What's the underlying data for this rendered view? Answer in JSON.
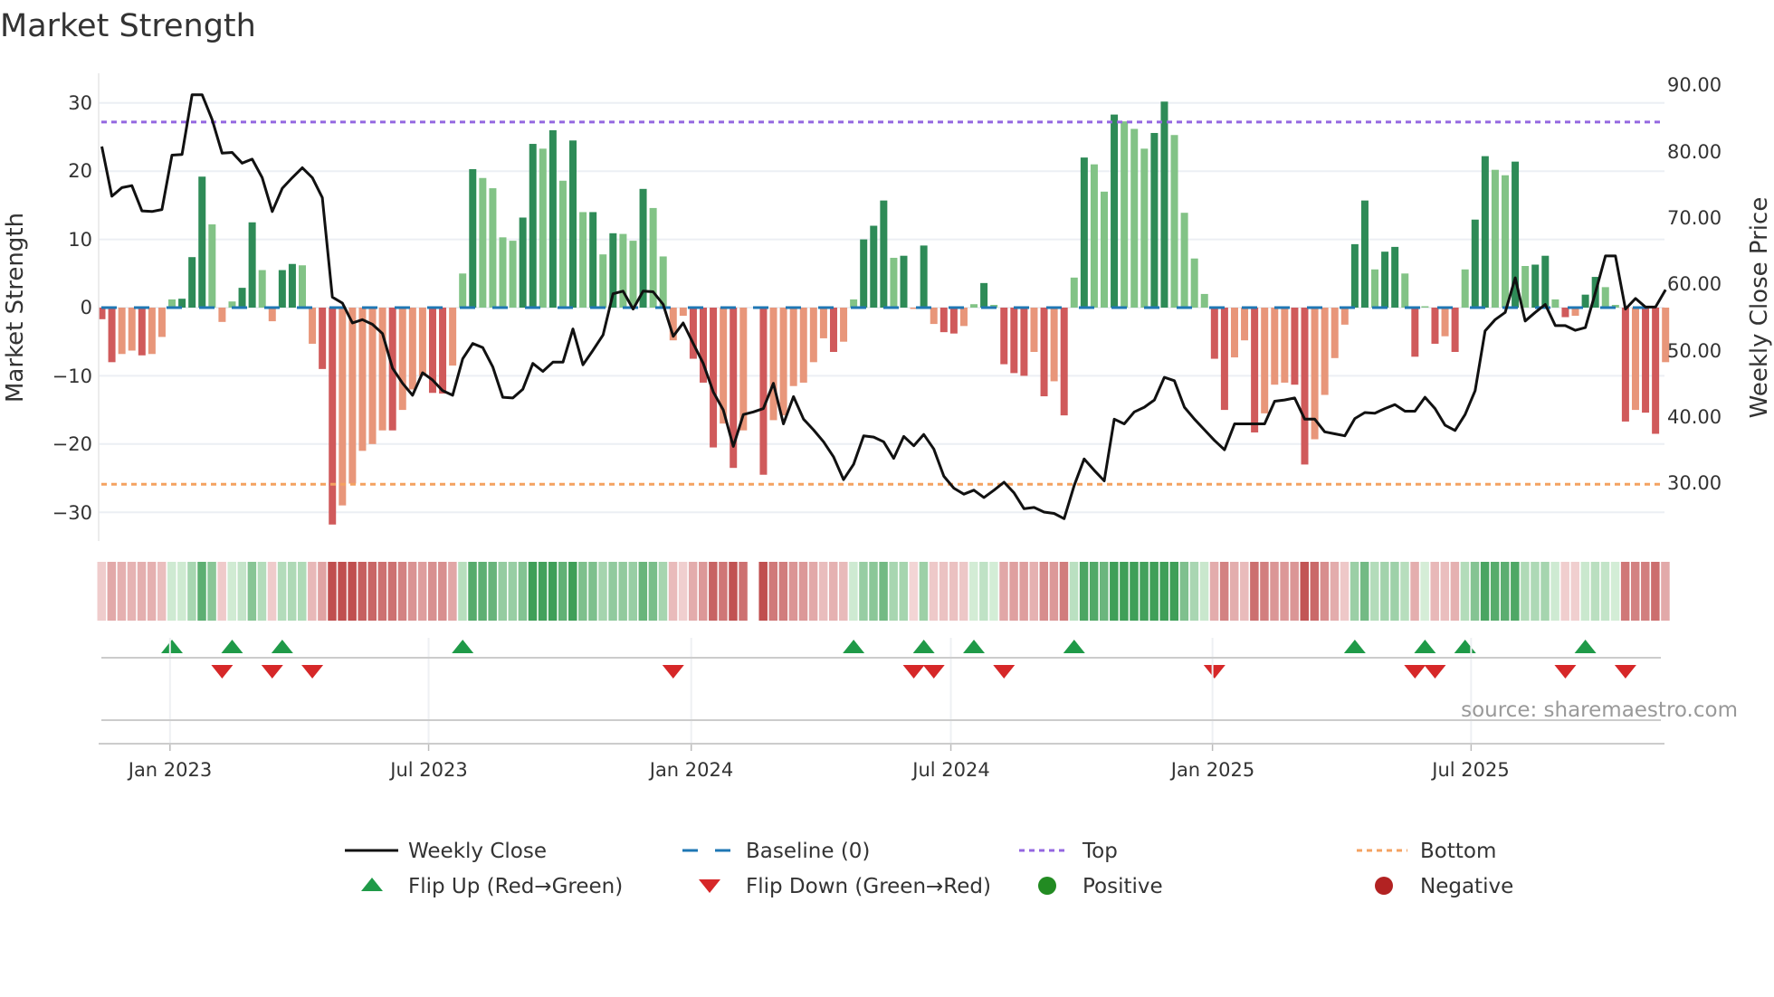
{
  "chart_data": {
    "type": "bar",
    "title": "Market Strength",
    "ylabel": "Market Strength",
    "y2label": "Weekly Close Price",
    "ylim": [
      -34.5,
      34.5
    ],
    "y2lim": [
      21.3,
      91.7
    ],
    "yticks": [
      {
        "value": 30,
        "label": "30"
      },
      {
        "value": 20,
        "label": "20"
      },
      {
        "value": 10,
        "label": "10"
      },
      {
        "value": 0,
        "label": "0"
      },
      {
        "value": -10,
        "label": "−10"
      },
      {
        "value": -20,
        "label": "−20"
      },
      {
        "value": -30,
        "label": "−30"
      }
    ],
    "y2ticks": [
      {
        "value": 90,
        "label": "90.00"
      },
      {
        "value": 80,
        "label": "80.00"
      },
      {
        "value": 70,
        "label": "70.00"
      },
      {
        "value": 60,
        "label": "60.00"
      },
      {
        "value": 50,
        "label": "50.00"
      },
      {
        "value": 40,
        "label": "40.00"
      },
      {
        "value": 30,
        "label": "30.00"
      }
    ],
    "xticks": [
      {
        "week": 6.8,
        "label": "Jan 2023"
      },
      {
        "week": 32.6,
        "label": "Jul 2023"
      },
      {
        "week": 58.8,
        "label": "Jan 2024"
      },
      {
        "week": 84.7,
        "label": "Jul 2024"
      },
      {
        "week": 110.8,
        "label": "Jan 2025"
      },
      {
        "week": 136.6,
        "label": "Jul 2025"
      }
    ],
    "grid": true,
    "top_threshold": 27.2,
    "bottom_threshold": -25.9,
    "strength": [
      -1.7,
      -8,
      -6.8,
      -6.3,
      -7,
      -6.8,
      -4.3,
      1.2,
      1.3,
      7.4,
      19.2,
      12.2,
      -2.1,
      0.9,
      2.9,
      12.5,
      5.5,
      -2,
      5.5,
      6.4,
      6.2,
      -5.3,
      -9,
      -31.8,
      -29,
      -25.8,
      -21,
      -20,
      -18,
      -18,
      -15,
      -12,
      -10,
      -12.5,
      -12.6,
      -8.5,
      5,
      20.3,
      19,
      17.5,
      10.3,
      9.8,
      13.2,
      24,
      23.3,
      26,
      18.6,
      24.5,
      14,
      14,
      7.8,
      10.9,
      10.8,
      9.8,
      17.4,
      14.6,
      7.5,
      -4.8,
      -1.2,
      -7.5,
      -11,
      -20.5,
      -17,
      -23.5,
      -18,
      null,
      -24.5,
      -16.5,
      -15.8,
      -11.5,
      -11,
      -8,
      -4.5,
      -6.5,
      -5,
      1.2,
      10,
      12,
      15.7,
      7.3,
      7.6,
      -0.2,
      9.1,
      -2.4,
      -3.6,
      -3.8,
      -2.7,
      0.5,
      3.6,
      0.4,
      -8.3,
      -9.6,
      -10,
      -6.5,
      -13,
      -10.8,
      -15.8,
      4.4,
      22,
      21,
      17,
      28.3,
      27.3,
      26.2,
      23.3,
      25.6,
      30.2,
      25.3,
      13.9,
      7.2,
      2,
      -7.5,
      -15,
      -7.3,
      -4.8,
      -18.3,
      -15.5,
      -11.3,
      -11,
      -11.3,
      -23,
      -19.3,
      -12.8,
      -7.4,
      -2.5,
      9.3,
      15.7,
      5.6,
      8.2,
      8.9,
      5,
      -7.2,
      0.2,
      -5.3,
      -4.2,
      -6.5,
      5.6,
      12.9,
      22.2,
      20.2,
      19.4,
      21.4,
      6.1,
      6.3,
      7.6,
      1.2,
      -1.4,
      -1.2,
      1.9,
      4.5,
      3,
      0.4,
      -16.7,
      -15,
      -15.4,
      -18.5,
      -8
    ],
    "weekly_close": [
      80.7,
      73.2,
      74.5,
      74.8,
      71,
      70.9,
      71.2,
      79.4,
      79.5,
      88.5,
      88.5,
      84.8,
      79.7,
      79.8,
      78.2,
      78.8,
      76,
      70.9,
      74.4,
      76,
      77.5,
      76,
      73,
      58,
      57.1,
      54.1,
      54.6,
      53.9,
      52.5,
      47.3,
      45,
      43.2,
      46.6,
      45.5,
      43.9,
      43.2,
      48.7,
      51,
      50.4,
      47.5,
      42.9,
      42.8,
      44.1,
      48,
      46.8,
      48.2,
      48.2,
      53.2,
      47.8,
      50,
      52.3,
      58.5,
      58.9,
      56.2,
      58.9,
      58.8,
      56.9,
      52.1,
      54.1,
      51,
      48,
      43.7,
      41,
      35.5,
      40.3,
      40.7,
      41.2,
      45,
      38.9,
      43,
      39.6,
      38,
      36.2,
      33.9,
      30.5,
      32.8,
      37.1,
      36.9,
      36.2,
      33.7,
      37,
      35.6,
      37.3,
      35.1,
      31,
      29.2,
      28.3,
      28.9,
      27.8,
      28.9,
      30.1,
      28.5,
      26.1,
      26.3,
      25.6,
      25.4,
      24.6,
      29.6,
      33.6,
      31.9,
      30.3,
      39.6,
      38.9,
      40.7,
      41.4,
      42.5,
      45.9,
      45.4,
      41.4,
      39.6,
      38,
      36.4,
      35,
      38.9,
      38.9,
      38.9,
      38.9,
      42.3,
      42.5,
      42.8,
      39.6,
      39.6,
      37.7,
      37.4,
      37.1,
      39.7,
      40.6,
      40.5,
      41.2,
      41.8,
      40.8,
      40.8,
      42.9,
      41.2,
      38.7,
      37.9,
      40.3,
      43.9,
      52.9,
      54.6,
      55.7,
      60.9,
      54.4,
      55.7,
      56.9,
      53.7,
      53.7,
      53,
      53.4,
      58.7,
      64.2,
      64.2,
      56.2,
      57.8,
      56.5,
      56.5,
      59.1
    ],
    "flip_up_weeks": [
      7,
      13,
      18,
      36,
      75,
      82,
      87,
      97,
      125,
      132,
      136,
      148
    ],
    "flip_down_weeks": [
      12,
      17,
      21,
      57,
      81,
      83,
      90,
      111,
      131,
      133,
      146,
      152
    ],
    "legend": [
      {
        "label": "Weekly Close",
        "symbol": "line",
        "color": "#111111"
      },
      {
        "label": "Baseline (0)",
        "symbol": "dash",
        "color": "#1f77b4"
      },
      {
        "label": "Top",
        "symbol": "dot",
        "color": "#9467e0"
      },
      {
        "label": "Bottom",
        "symbol": "dot",
        "color": "#f4a261"
      },
      {
        "label": "Flip Up (Red→Green)",
        "symbol": "triangle-up",
        "color": "#1f9a48"
      },
      {
        "label": "Flip Down (Green→Red)",
        "symbol": "triangle-down",
        "color": "#d62728"
      },
      {
        "label": "Positive",
        "symbol": "circle",
        "color": "#228b22"
      },
      {
        "label": "Negative",
        "symbol": "circle",
        "color": "#b22222"
      }
    ],
    "legend_position": "bottom",
    "source": "source: sharemaestro.com"
  },
  "colors": {
    "pos_strong": "#2e8b57",
    "pos_weak": "#82c386",
    "neg_strong": "#d05a5b",
    "neg_weak": "#e8967a",
    "grid": "#eceff4",
    "axis": "#cccccc"
  }
}
